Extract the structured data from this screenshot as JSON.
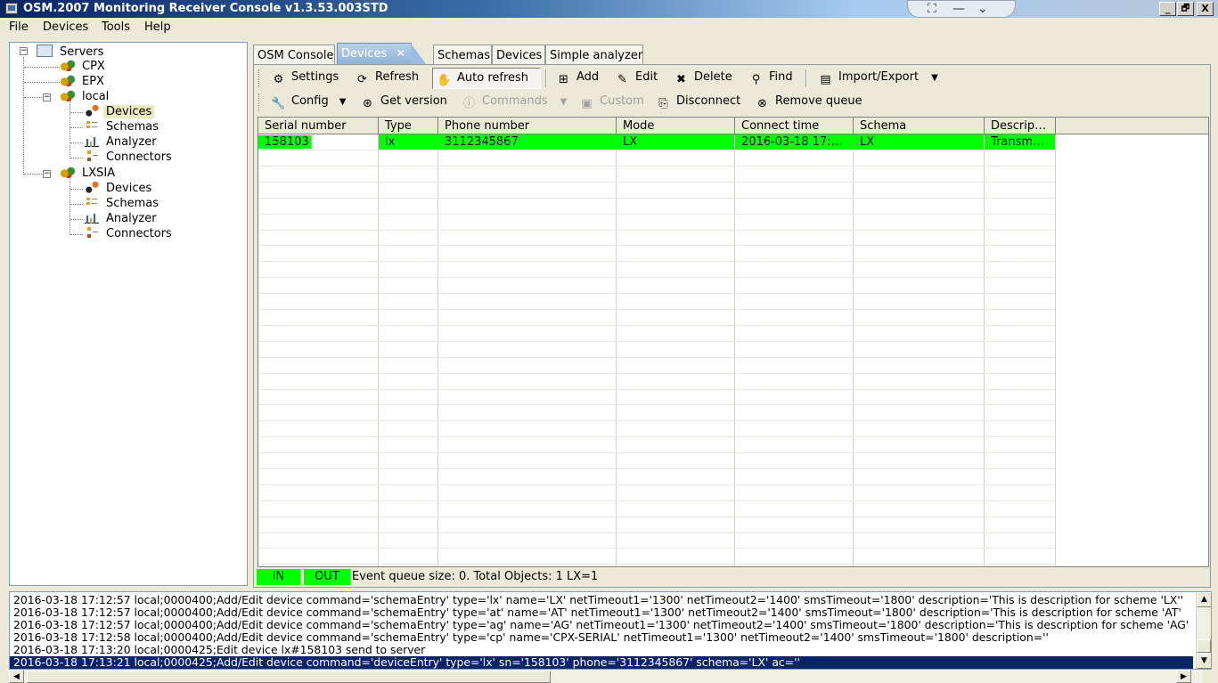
{
  "window": {
    "title": "OSM.2007 Monitoring Receiver Console v1.3.53.003STD",
    "controls": {
      "minimize": "_",
      "restore": "🗗",
      "close": "X"
    }
  },
  "menu": [
    "File",
    "Devices",
    "Tools",
    "Help"
  ],
  "tree": {
    "root": "Servers",
    "servers": [
      {
        "label": "CPX"
      },
      {
        "label": "EPX"
      },
      {
        "label": "local",
        "children": [
          "Devices",
          "Schemas",
          "Analyzer",
          "Connectors"
        ],
        "selected": "Devices"
      },
      {
        "label": "LXSIA",
        "children": [
          "Devices",
          "Schemas",
          "Analyzer",
          "Connectors"
        ]
      }
    ]
  },
  "tabs": [
    "OSM Console",
    "Devices",
    "Schemas",
    "Devices",
    "Simple analyzer"
  ],
  "active_tab_index": 1,
  "toolbar1": [
    "Settings",
    "Refresh",
    "Auto refresh",
    "Add",
    "Edit",
    "Delete",
    "Find",
    "Import/Export"
  ],
  "toolbar2": [
    "Config",
    "Get version",
    "Commands",
    "Custom",
    "Disconnect",
    "Remove queue"
  ],
  "table": {
    "columns": [
      "Serial number",
      "Type",
      "Phone number",
      "Mode",
      "Connect time",
      "Schema",
      "Descrip…"
    ],
    "rows": [
      [
        "158103",
        "lx",
        "3112345867",
        "LX",
        "2016-03-18 17:…",
        "LX",
        "Transm…"
      ]
    ],
    "row_color": "#00ff00"
  },
  "status": {
    "in": "IN",
    "out": "OUT",
    "text": "Event queue size: 0.  Total Objects: 1   LX=1"
  },
  "log": [
    "2016-03-18 17:12:57  local;0000400;Add/Edit device command='schemaEntry' type='lx' name='LX' netTimeout1='1300' netTimeout2='1400' smsTimeout='1800' description='This is description for scheme 'LX''",
    "2016-03-18 17:12:57  local;0000400;Add/Edit device command='schemaEntry' type='at' name='AT' netTimeout1='1300' netTimeout2='1400' smsTimeout='1800' description='This is description for scheme 'AT'",
    "2016-03-18 17:12:57  local;0000400;Add/Edit device command='schemaEntry' type='ag' name='AG' netTimeout1='1300' netTimeout2='1400' smsTimeout='1800' description='This is description for scheme 'AG'",
    "2016-03-18 17:12:58  local;0000400;Add/Edit device command='schemaEntry' type='cp' name='CPX-SERIAL' netTimeout1='1300' netTimeout2='1400' smsTimeout='1800' description=''",
    "2016-03-18 17:13:20  local;0000425;Edit device lx#158103 send to server",
    "2016-03-18 17:13:21  local;0000425;Add/Edit device command='deviceEntry' type='lx' sn='158103' phone='3112345867' schema='LX' ac=''"
  ]
}
